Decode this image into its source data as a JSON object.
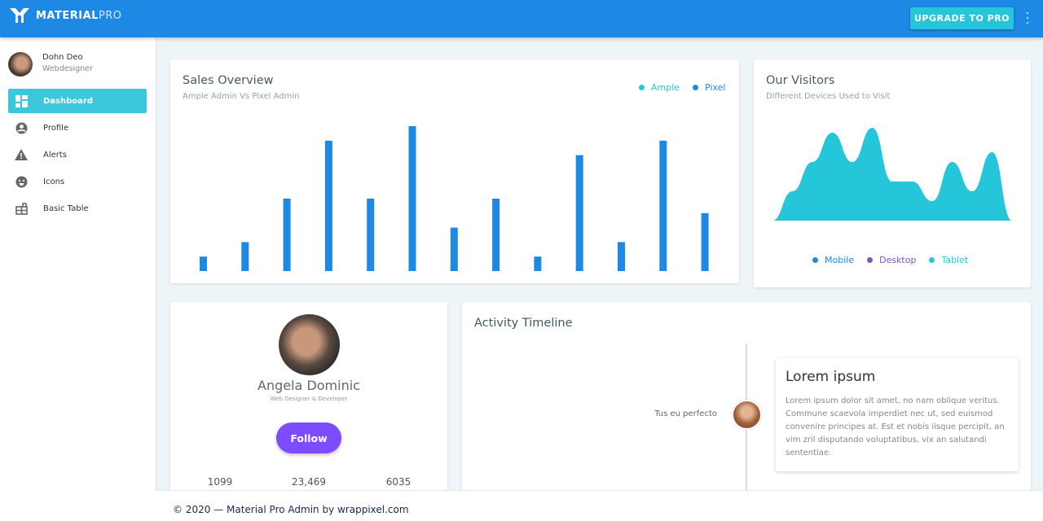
{
  "header": {
    "logo_bold": "MATERIAL",
    "logo_light": "PRO",
    "upgrade_label": "UPGRADE TO PRO",
    "menu_icon": "more-vertical-icon"
  },
  "sidebar": {
    "user": {
      "name": "Dohn Deo",
      "role": "Webdesigner"
    },
    "items": [
      {
        "label": "Dashboard",
        "icon": "dashboard-icon",
        "active": true
      },
      {
        "label": "Profile",
        "icon": "account-circle-icon"
      },
      {
        "label": "Alerts",
        "icon": "warning-icon"
      },
      {
        "label": "Icons",
        "icon": "emoji-icon"
      },
      {
        "label": "Basic Table",
        "icon": "table-icon"
      }
    ]
  },
  "sales": {
    "title": "Sales Overview",
    "subtitle": "Ample Admin Vs Pixel Admin",
    "legend": [
      {
        "label": "Ample",
        "color": "#26c6da"
      },
      {
        "label": "Pixel",
        "color": "#1e88e5"
      }
    ]
  },
  "visitors": {
    "title": "Our Visitors",
    "subtitle": "Different Devices Used to Visit",
    "legend": [
      {
        "label": "Mobile",
        "color": "#1e88e5"
      },
      {
        "label": "Desktop",
        "color": "#7e57c2"
      },
      {
        "label": "Tablet",
        "color": "#26c6da"
      }
    ]
  },
  "profile": {
    "name": "Angela Dominic",
    "role": "Web Designer & Developer",
    "follow_label": "Follow",
    "stats": [
      "1099",
      "23,469",
      "6035"
    ]
  },
  "timeline": {
    "title": "Activity Timeline",
    "left_text": "Tus eu perfecto",
    "item_title": "Lorem ipsum",
    "item_body": "Lorem ipsum dolor sit amet, no nam oblique veritus. Commune scaevola imperdiet nec ut, sed euismod convenire principes at. Est et nobis iisque percipit, an vim zril disputando voluptatibus, vix an salutandi sententiae."
  },
  "footer": {
    "text": "© 2020 — Material Pro Admin by wrappixel.com"
  },
  "chart_data": [
    {
      "type": "bar",
      "values": [
        1,
        2,
        5,
        9,
        5,
        10,
        3,
        5,
        1,
        8,
        2,
        9,
        4
      ],
      "color": "#1e88e5",
      "grid": false
    },
    {
      "type": "area",
      "values": [
        0,
        3,
        6,
        9,
        6,
        9.5,
        4,
        4,
        2,
        6,
        3,
        7,
        0
      ],
      "color": "#26c6da",
      "grid": false
    }
  ]
}
